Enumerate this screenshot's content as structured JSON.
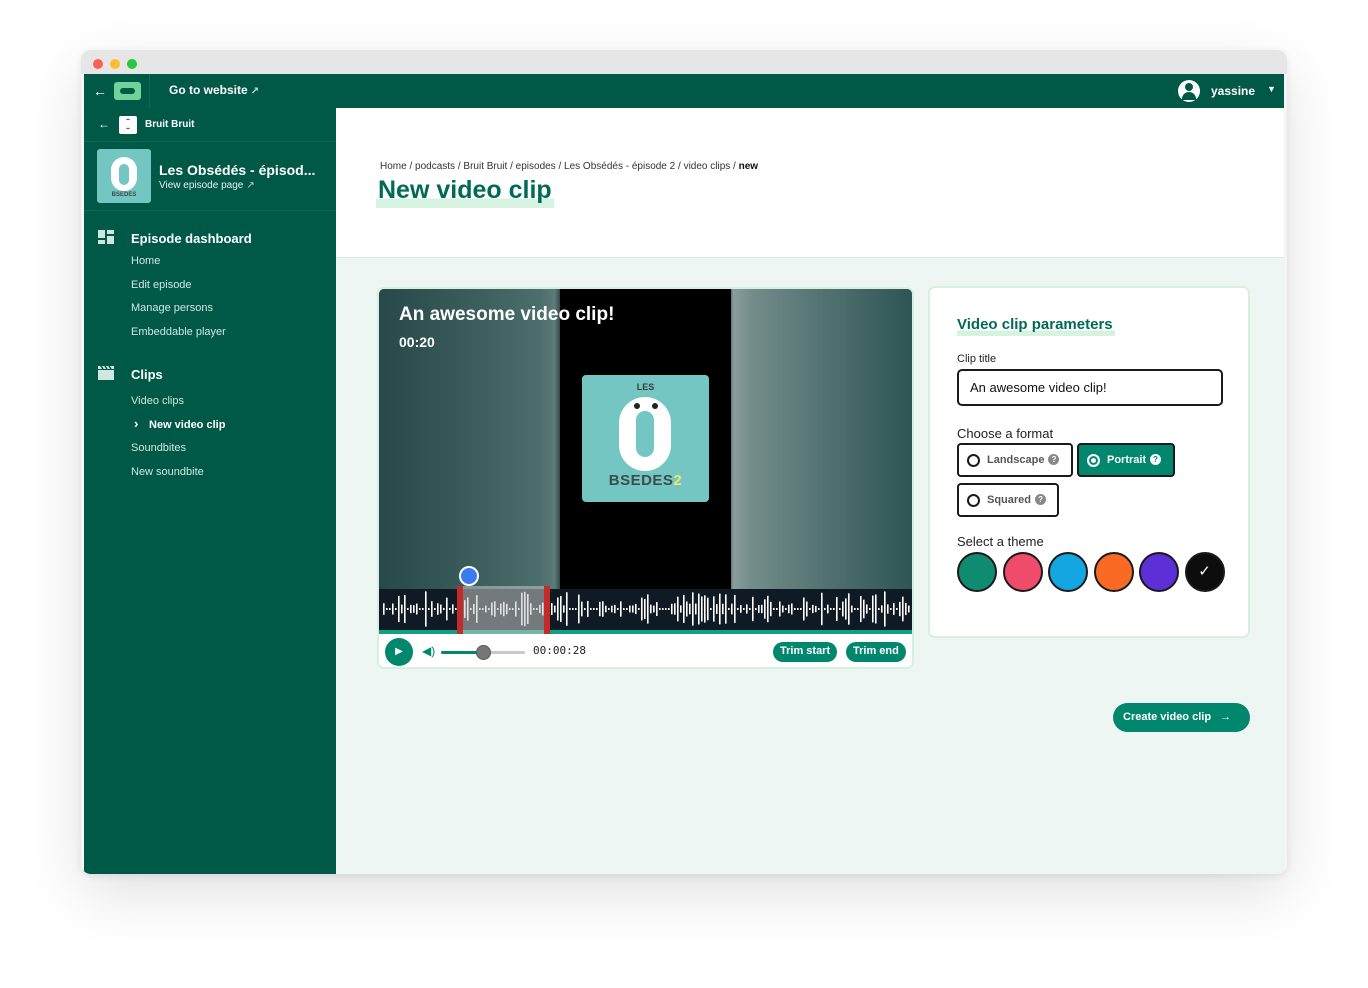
{
  "window": {
    "dot_colors": [
      "#fe5f57",
      "#febc2e",
      "#28c840"
    ]
  },
  "topbar": {
    "back_icon": "arrow-left-icon",
    "logo_icon": "ausha-logo-icon",
    "goto_label": "Go to website",
    "goto_icon": "external-link-icon",
    "user_name": "yassine",
    "user_icon": "user-avatar-icon",
    "caret_icon": "caret-down-icon"
  },
  "sidebar": {
    "podcast_name": "Bruit Bruit",
    "episode_title": "Les Obsédés - épisod...",
    "episode_link": "View episode page",
    "sections": [
      {
        "title": "Episode dashboard",
        "icon": "dashboard-icon",
        "items": [
          {
            "label": "Home"
          },
          {
            "label": "Edit episode"
          },
          {
            "label": "Manage persons"
          },
          {
            "label": "Embeddable player"
          }
        ]
      },
      {
        "title": "Clips",
        "icon": "clapperboard-icon",
        "items": [
          {
            "label": "Video clips"
          },
          {
            "label": "New video clip",
            "active": true
          },
          {
            "label": "Soundbites"
          },
          {
            "label": "New soundbite"
          }
        ]
      }
    ]
  },
  "header": {
    "breadcrumbs": [
      "Home",
      "podcasts",
      "Bruit Bruit",
      "episodes",
      "Les Obsédés - épisode 2",
      "video clips"
    ],
    "breadcrumb_current": "new",
    "page_title": "New video clip"
  },
  "player": {
    "clip_title": "An awesome video clip!",
    "clip_duration": "00:20",
    "cover_top": "LES",
    "cover_word": "BSEDES",
    "cover_number": "2",
    "time": "00:00:28",
    "volume_fraction": 0.5,
    "trim_start": "Trim start",
    "trim_end": "Trim end"
  },
  "params": {
    "title": "Video clip parameters",
    "clip_title_label": "Clip title",
    "clip_title_value": "An awesome video clip!",
    "format_label": "Choose a format",
    "formats": [
      {
        "label": "Landscape",
        "selected": false
      },
      {
        "label": "Portrait",
        "selected": true
      },
      {
        "label": "Squared",
        "selected": false
      }
    ],
    "theme_label": "Select a theme",
    "themes": [
      {
        "color": "#0f8b72"
      },
      {
        "color": "#ef4b6a"
      },
      {
        "color": "#14a6e0"
      },
      {
        "color": "#fb6a25"
      },
      {
        "color": "#5d2fd6"
      },
      {
        "color": "#0d0d0d",
        "selected": true
      }
    ]
  },
  "create_button": "Create video clip",
  "create_icon": "arrow-right-icon"
}
